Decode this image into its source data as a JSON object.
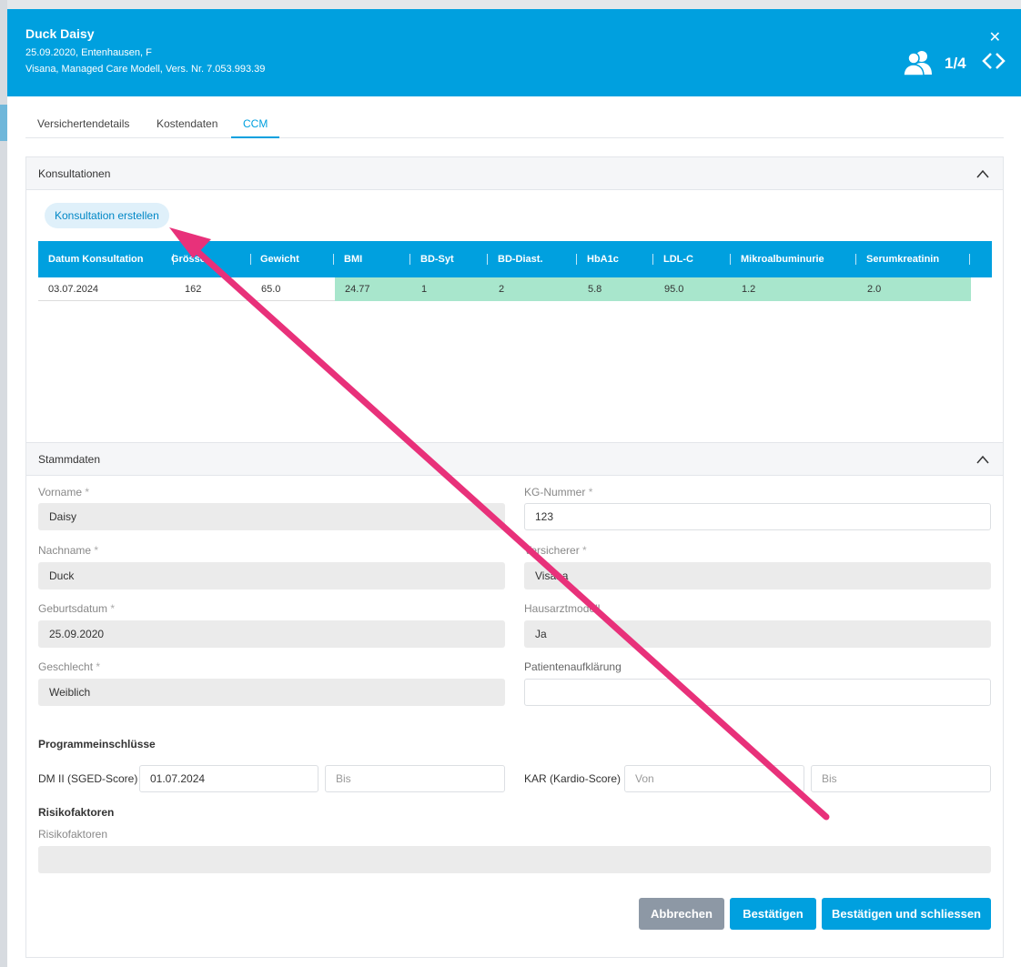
{
  "patient": {
    "name": "Duck Daisy",
    "line1": "25.09.2020, Entenhausen, F",
    "line2": "Visana, Managed Care Modell, Vers. Nr. 7.053.993.39",
    "close": "✕",
    "counter": "1/4"
  },
  "tabs": [
    {
      "label": "Versichertendetails"
    },
    {
      "label": "Kostendaten"
    },
    {
      "label": "CCM",
      "active": true
    }
  ],
  "konsultationen": {
    "title": "Konsultationen",
    "create_button": "Konsultation erstellen",
    "columns": [
      "Datum Konsultation",
      "Grösse",
      "Gewicht",
      "BMI",
      "BD-Syt",
      "BD-Diast.",
      "HbA1c",
      "LDL-C",
      "Mikroalbuminurie",
      "Serumkreatinin"
    ],
    "rows": [
      [
        "03.07.2024",
        "162",
        "65.0",
        "24.77",
        "1",
        "2",
        "5.8",
        "95.0",
        "1.2",
        "2.0"
      ]
    ]
  },
  "stammdaten": {
    "title": "Stammdaten",
    "vorname": {
      "label": "Vorname",
      "value": "Daisy"
    },
    "kg_nummer": {
      "label": "KG-Nummer",
      "value": "123"
    },
    "nachname": {
      "label": "Nachname",
      "value": "Duck"
    },
    "versicherer": {
      "label": "Versicherer",
      "value": "Visana"
    },
    "geburtsdatum": {
      "label": "Geburtsdatum",
      "value": "25.09.2020"
    },
    "hausarztmodell": {
      "label": "Hausarztmodell",
      "value": "Ja"
    },
    "geschlecht": {
      "label": "Geschlecht",
      "value": "Weiblich"
    },
    "patientenaufklaerung": {
      "label": "Patientenaufklärung",
      "value": ""
    },
    "required_mark": "*"
  },
  "programme": {
    "title": "Programmeinschlüsse",
    "dm2": {
      "label": "DM II (SGED-Score)",
      "von": "01.07.2024",
      "bis_placeholder": "Bis"
    },
    "kar": {
      "label": "KAR (Kardio-Score)",
      "von_placeholder": "Von",
      "bis_placeholder": "Bis"
    }
  },
  "risiko": {
    "title": "Risikofaktoren",
    "label": "Risikofaktoren",
    "value": ""
  },
  "buttons": {
    "cancel": "Abbrechen",
    "confirm": "Bestätigen",
    "confirm_close": "Bestätigen und schliessen"
  },
  "colors": {
    "header": "#00a0df",
    "highlight_row": "#a8e6cc",
    "annotation_arrow": "#e8317a"
  }
}
